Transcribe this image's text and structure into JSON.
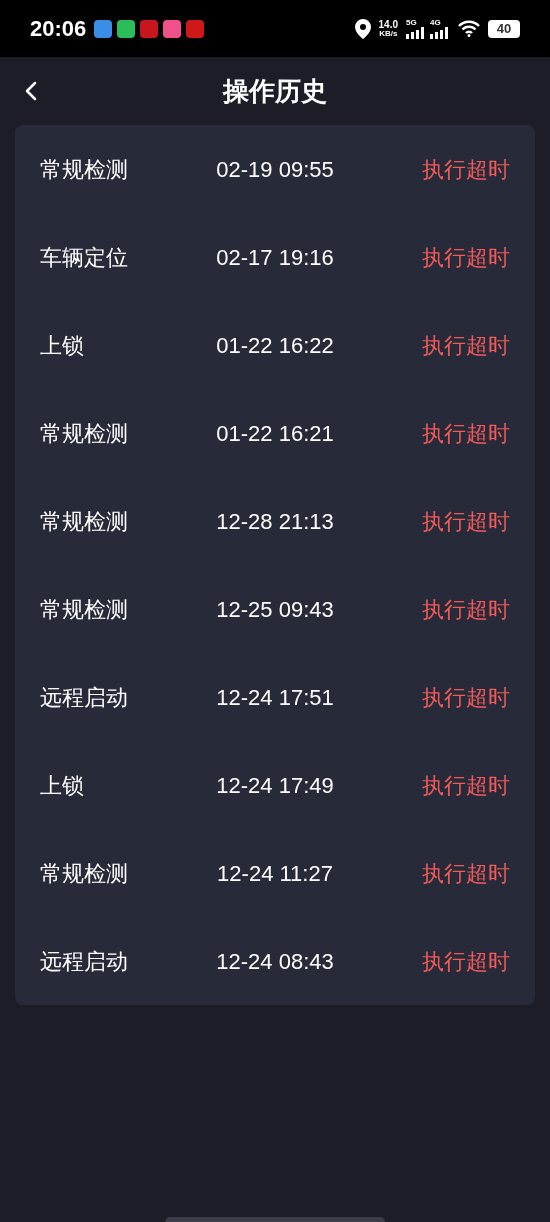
{
  "status_bar": {
    "time": "20:06",
    "notification_icons": [
      {
        "color": "#3a8ee6"
      },
      {
        "color": "#2bbd5a"
      },
      {
        "color": "#c8161d"
      },
      {
        "color": "#f0508c"
      },
      {
        "color": "#d01818"
      }
    ],
    "speed": "14.0",
    "speed_unit": "KB/s",
    "network_1": "5G",
    "network_2": "4G",
    "battery": "40"
  },
  "header": {
    "title": "操作历史"
  },
  "history": [
    {
      "action": "常规检测",
      "time": "02-19 09:55",
      "result": "执行超时"
    },
    {
      "action": "车辆定位",
      "time": "02-17 19:16",
      "result": "执行超时"
    },
    {
      "action": "上锁",
      "time": "01-22 16:22",
      "result": "执行超时"
    },
    {
      "action": "常规检测",
      "time": "01-22 16:21",
      "result": "执行超时"
    },
    {
      "action": "常规检测",
      "time": "12-28 21:13",
      "result": "执行超时"
    },
    {
      "action": "常规检测",
      "time": "12-25 09:43",
      "result": "执行超时"
    },
    {
      "action": "远程启动",
      "time": "12-24 17:51",
      "result": "执行超时"
    },
    {
      "action": "上锁",
      "time": "12-24 17:49",
      "result": "执行超时"
    },
    {
      "action": "常规检测",
      "time": "12-24 11:27",
      "result": "执行超时"
    },
    {
      "action": "远程启动",
      "time": "12-24 08:43",
      "result": "执行超时"
    }
  ]
}
